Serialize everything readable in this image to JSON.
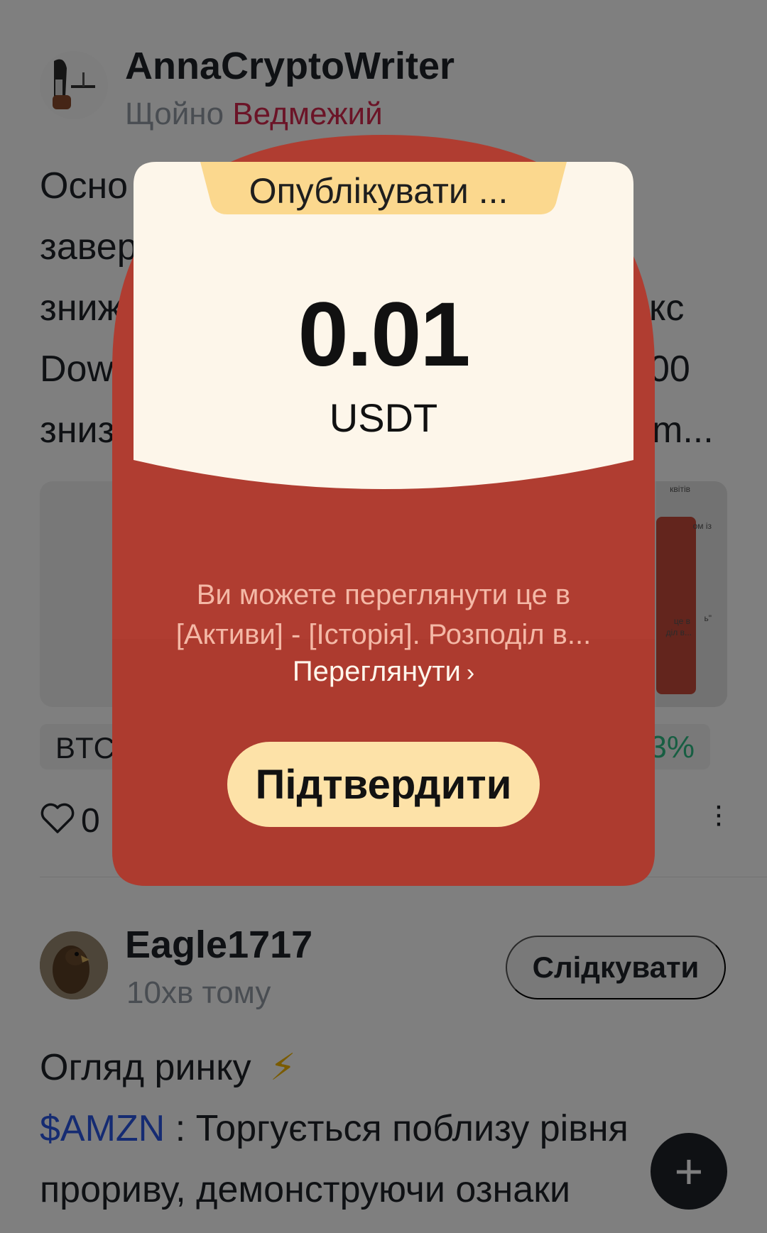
{
  "post1": {
    "author": "AnnaCryptoWriter",
    "time": "Щойно",
    "sentiment": "Ведмежий",
    "body_lines": [
      "Осно",
      "завер",
      "зниж",
      "Dow",
      "зниз"
    ],
    "body_line_ends": [
      "",
      "",
      "кс",
      "00",
      "m..."
    ],
    "image_texts": [
      "квітів",
      "ом із",
      "це в",
      "діл в...",
      "ь\""
    ],
    "ticker": {
      "symbol": "BTC",
      "change": "3%"
    },
    "likes": "0"
  },
  "post2": {
    "author": "Eagle1717",
    "time": "10хв тому",
    "follow_label": "Слідкувати",
    "title": "Огляд ринку",
    "title_emoji": "⚡",
    "cashtag": "$AMZN",
    "line1_rest": " : Торгується поблизу рівня",
    "line2": "прориву, демонструючи ознаки"
  },
  "modal": {
    "tab_title": "Опублікувати ...",
    "amount": "0.01",
    "currency": "USDT",
    "info_line1": "Ви можете переглянути це в",
    "info_line2": "[Активи] - [Історія]. Розподіл в...",
    "view_label": "Переглянути",
    "confirm_label": "Підтвердити"
  },
  "colors": {
    "envelope_red": "#b03d31",
    "card_cream": "#fdf6ea",
    "tab_yellow": "#fbd88e",
    "button_yellow": "#fde2a8",
    "sentiment_red": "#d6294f",
    "cashtag_blue": "#2a56e5"
  },
  "icons": {
    "fab": "plus-icon",
    "like": "heart-icon",
    "more": "more-vertical-icon",
    "chevron": "chevron-right-icon"
  }
}
